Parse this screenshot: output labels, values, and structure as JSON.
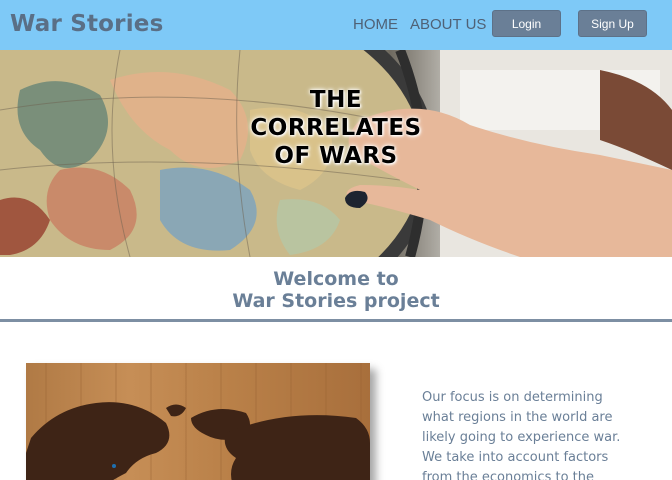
{
  "navbar": {
    "brand": "War Stories",
    "links": [
      {
        "label": "HOME"
      },
      {
        "label": "ABOUT US"
      }
    ],
    "login_label": "Login",
    "signup_label": "Sign Up"
  },
  "hero": {
    "title_line1": "THE",
    "title_line2": "CORRELATES",
    "title_line3": "OF WARS"
  },
  "welcome": {
    "line1": "Welcome to",
    "line2": "War Stories project"
  },
  "content": {
    "focus_text": "Our focus is on determining what regions in the world are likely going to experience war. We take into account factors from the economics to the"
  },
  "colors": {
    "navbar_bg": "#7ec9f7",
    "accent": "#6a7f97",
    "button_bg": "#6a7f97"
  },
  "icons": {
    "hero_image": "globe-with-hand",
    "map_image": "wooden-world-map"
  }
}
